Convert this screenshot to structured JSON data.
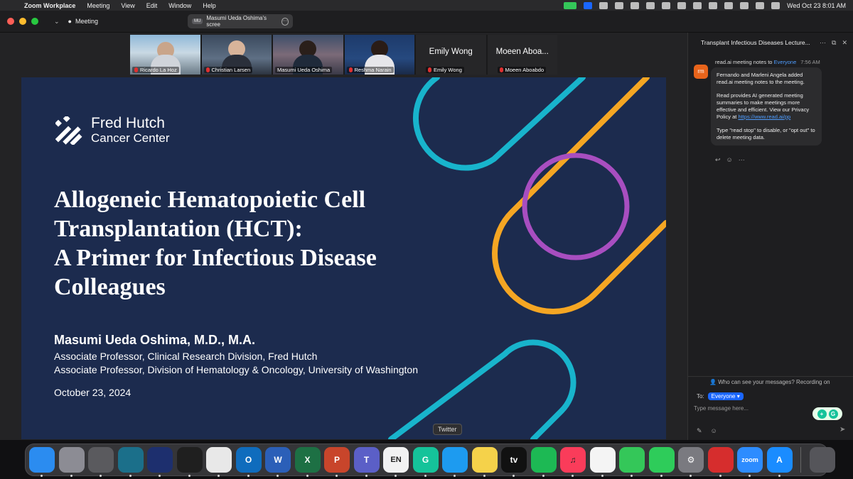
{
  "menubar": {
    "app_name": "Zoom Workplace",
    "items": [
      "Meeting",
      "View",
      "Edit",
      "Window",
      "Help"
    ],
    "clock": "Wed Oct 23  8:01 AM"
  },
  "titlebar": {
    "meeting_label": "Meeting",
    "share_badge": "MU",
    "share_label": "Masumi Ueda Oshima's scree"
  },
  "participants": [
    {
      "name": "Ricardo La Hoz",
      "video": true,
      "muted": true
    },
    {
      "name": "Christian Larsen",
      "video": true,
      "muted": true
    },
    {
      "name": "Masumi Ueda Oshima",
      "video": true,
      "muted": false,
      "speaking": true
    },
    {
      "name": "Reshma Narain",
      "video": true,
      "muted": true
    },
    {
      "name": "Emily Wong",
      "big_name": "Emily Wong",
      "video": false,
      "muted": true
    },
    {
      "name": "Moeen Aboabdo",
      "big_name": "Moeen Aboa...",
      "video": false,
      "muted": true
    }
  ],
  "slide": {
    "logo_line1": "Fred Hutch",
    "logo_line2": "Cancer Center",
    "title_lines": [
      "Allogeneic Hematopoietic Cell",
      "Transplantation (HCT):",
      "A Primer for Infectious Disease",
      "Colleagues"
    ],
    "presenter": "Masumi Ueda Oshima, M.D., M.A.",
    "affiliation1": "Associate Professor, Clinical Research Division, Fred Hutch",
    "affiliation2": "Associate Professor, Division of Hematology & Oncology,  University of Washington",
    "date": "October 23, 2024",
    "colors": {
      "background": "#1c2b4e",
      "cyan": "#18b4cc",
      "orange": "#f5a623",
      "purple": "#a84ec0"
    }
  },
  "tooltip": "Twitter",
  "chat": {
    "title": "Transplant Infectious Diseases Lecture...",
    "avatar": "rm",
    "sender": "read.ai meeting notes",
    "to_word": " to ",
    "to_audience": "Everyone",
    "time": "7:56 AM",
    "p1": "Fernando and Marleni Angela added read.ai meeting notes to the meeting.",
    "p2_text": "Read provides AI generated meeting summaries to make meetings more effective and efficient. View our Privacy Policy at ",
    "p2_link": "https://www.read.ai/pp",
    "p3": "Type \"read stop\" to disable, or \"opt out\" to delete meeting data.",
    "privacy_notice": "Who can see your messages? Recording on",
    "to_label": "To:",
    "recipient": "Everyone",
    "input_placeholder": "Type message here..."
  },
  "dock": [
    {
      "name": "finder-icon",
      "label": "",
      "bg": "#2b8cf0"
    },
    {
      "name": "launchpad-icon",
      "label": "",
      "bg": "#8c8c94"
    },
    {
      "name": "calculator-icon",
      "label": "",
      "bg": "#5a5a5e"
    },
    {
      "name": "kindle-icon",
      "label": "",
      "bg": "#1b6f8a"
    },
    {
      "name": "webex-icon",
      "label": "",
      "bg": "#1d2f6e"
    },
    {
      "name": "chatgpt-icon",
      "label": "",
      "bg": "#1f1f1f"
    },
    {
      "name": "chrome-icon",
      "label": "",
      "bg": "#e8e8e8"
    },
    {
      "name": "outlook-icon",
      "label": "O",
      "bg": "#0f6cbd"
    },
    {
      "name": "word-icon",
      "label": "W",
      "bg": "#2b5fb8"
    },
    {
      "name": "excel-icon",
      "label": "X",
      "bg": "#1d7044"
    },
    {
      "name": "powerpoint-icon",
      "label": "P",
      "bg": "#c8452b"
    },
    {
      "name": "teams-icon",
      "label": "T",
      "bg": "#5b5fc7"
    },
    {
      "name": "input-method-icon",
      "label": "EN",
      "bg": "#f2f2f2"
    },
    {
      "name": "grammarly-icon",
      "label": "G",
      "bg": "#15c39a"
    },
    {
      "name": "twitter-icon",
      "label": "",
      "bg": "#1d9bf0"
    },
    {
      "name": "notes-icon",
      "label": "",
      "bg": "#f5d24a"
    },
    {
      "name": "apple-tv-icon",
      "label": "tv",
      "bg": "#111111"
    },
    {
      "name": "spotify-icon",
      "label": "",
      "bg": "#1db954"
    },
    {
      "name": "music-icon",
      "label": "♫",
      "bg": "#fa3c5a"
    },
    {
      "name": "photos-icon",
      "label": "",
      "bg": "#f4f4f4"
    },
    {
      "name": "messages-icon",
      "label": "",
      "bg": "#34c759"
    },
    {
      "name": "facetime-icon",
      "label": "",
      "bg": "#2ecc5a"
    },
    {
      "name": "system-settings-icon",
      "label": "⚙",
      "bg": "#7a7a80"
    },
    {
      "name": "acrobat-icon",
      "label": "",
      "bg": "#d62d2d"
    },
    {
      "name": "zoom-icon",
      "label": "zoom",
      "bg": "#2d8cff"
    },
    {
      "name": "app-store-icon",
      "label": "A",
      "bg": "#1a8cff"
    },
    {
      "name": "trash-icon",
      "label": "",
      "bg": "#55555a"
    }
  ]
}
